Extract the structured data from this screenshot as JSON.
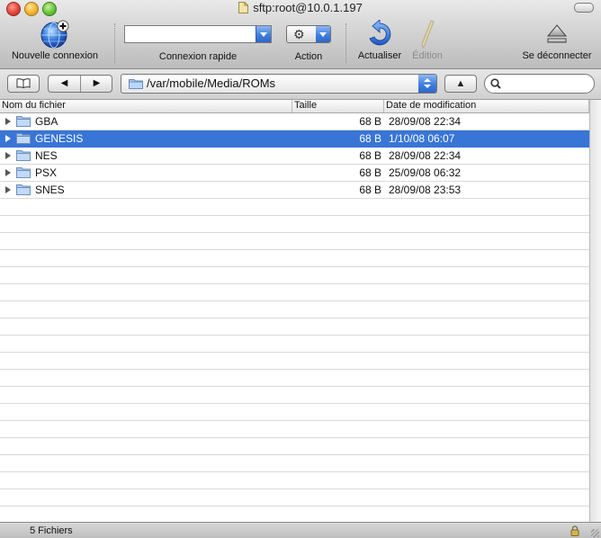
{
  "window": {
    "title": "sftp:root@10.0.1.197"
  },
  "toolbar": {
    "new_connection_label": "Nouvelle connexion",
    "quick_connect_label": "Connexion rapide",
    "quick_connect_value": "",
    "action_label": "Action",
    "refresh_label": "Actualiser",
    "edit_label": "Édition",
    "disconnect_label": "Se déconnecter"
  },
  "navbar": {
    "path": "/var/mobile/Media/ROMs",
    "search_value": "",
    "back_glyph": "◀",
    "forward_glyph": "▶",
    "up_glyph": "▲",
    "bookmarks_glyph": "📖"
  },
  "table": {
    "columns": [
      "Nom du fichier",
      "Taille",
      "Date de modification"
    ],
    "rows": [
      {
        "name": "GBA",
        "size": "68 B",
        "date": "28/09/08 22:34",
        "selected": false
      },
      {
        "name": "GENESIS",
        "size": "68 B",
        "date": "1/10/08 06:07",
        "selected": true
      },
      {
        "name": "NES",
        "size": "68 B",
        "date": "28/09/08 22:34",
        "selected": false
      },
      {
        "name": "PSX",
        "size": "68 B",
        "date": "25/09/08 06:32",
        "selected": false
      },
      {
        "name": "SNES",
        "size": "68 B",
        "date": "28/09/08 23:53",
        "selected": false
      }
    ]
  },
  "status": {
    "count": "5 Fichiers"
  },
  "colors": {
    "selection": "#3875d7",
    "accent_blue": "#3f7ee0"
  }
}
